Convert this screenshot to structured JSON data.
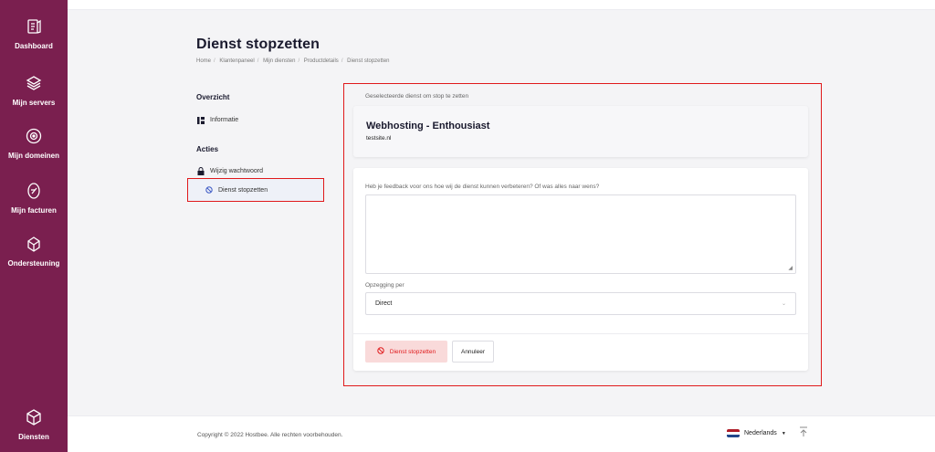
{
  "sidebar": {
    "items": [
      {
        "label": "Dashboard",
        "icon": "dashboard-icon"
      },
      {
        "label": "Mijn servers",
        "icon": "servers-icon"
      },
      {
        "label": "Mijn domeinen",
        "icon": "domains-icon"
      },
      {
        "label": "Mijn facturen",
        "icon": "invoices-icon"
      },
      {
        "label": "Ondersteuning",
        "icon": "support-icon"
      },
      {
        "label": "Diensten",
        "icon": "services-icon"
      }
    ]
  },
  "header": {
    "title": "Dienst stopzetten",
    "breadcrumb": [
      "Home",
      "Klantenpaneel",
      "Mijn diensten",
      "Productdetails",
      "Dienst stopzetten"
    ]
  },
  "menu": {
    "overview_heading": "Overzicht",
    "info_link": "Informatie",
    "actions_heading": "Acties",
    "password_link": "Wijzig wachtwoord",
    "cancel_link": "Dienst stopzetten"
  },
  "main": {
    "selected_caption": "Geselecteerde dienst om stop te zetten",
    "service_name": "Webhosting - Enthousiast",
    "service_domain": "testsite.nl",
    "feedback_label": "Heb je feedback voor ons hoe wij de dienst kunnen verbeteren? Of was alles naar wens?",
    "feedback_value": "",
    "termination_label": "Opzegging per",
    "termination_selected": "Direct",
    "stop_button": "Dienst stopzetten",
    "cancel_button": "Annuleer"
  },
  "footer": {
    "copyright": "Copyright © 2022 Hostbee. Alle rechten voorbehouden.",
    "language": "Nederlands"
  },
  "colors": {
    "sidebar": "#7a1f4f",
    "highlight": "#e0191b",
    "danger_bg": "#f9dada"
  }
}
